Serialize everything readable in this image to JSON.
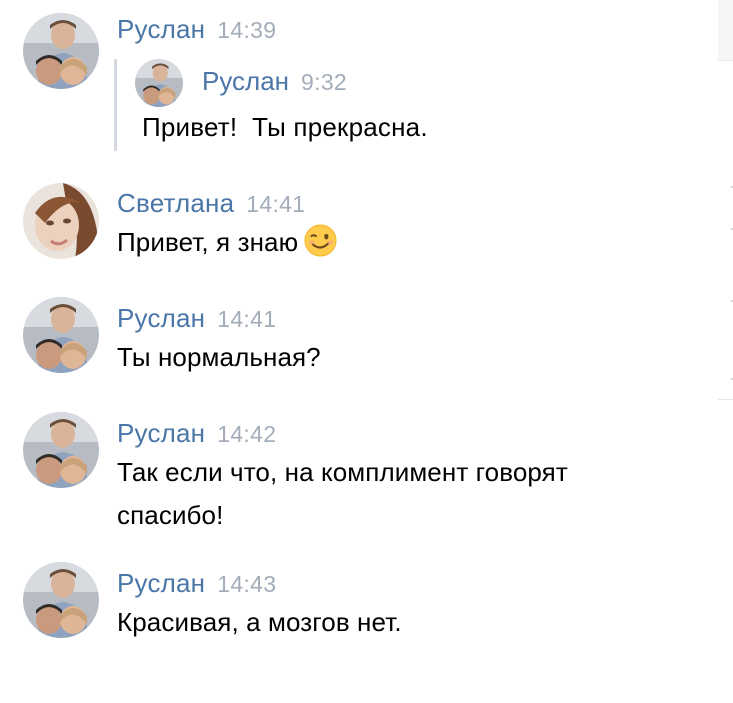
{
  "messages": [
    {
      "author": "Руслан",
      "time": "14:39",
      "avatar": "ruslan-avatar",
      "quote": {
        "author": "Руслан",
        "time": "9:32",
        "text": "Привет!  Ты прекрасна."
      }
    },
    {
      "author": "Светлана",
      "time": "14:41",
      "avatar": "svetlana-avatar",
      "text": "Привет, я знаю",
      "emoji": "winking-face-emoji"
    },
    {
      "author": "Руслан",
      "time": "14:41",
      "avatar": "ruslan-avatar",
      "text": "Ты нормальная?"
    },
    {
      "author": "Руслан",
      "time": "14:42",
      "avatar": "ruslan-avatar",
      "text_line1": "Так если что, на комплимент говорят",
      "text_line2": "спасибо!"
    },
    {
      "author": "Руслан",
      "time": "14:43",
      "avatar": "ruslan-avatar",
      "text": "Красивая, а мозгов нет."
    }
  ],
  "colors": {
    "author": "#4a76a8",
    "time": "#a3adba",
    "quote_bar": "#d3d9de",
    "text": "#000000"
  }
}
